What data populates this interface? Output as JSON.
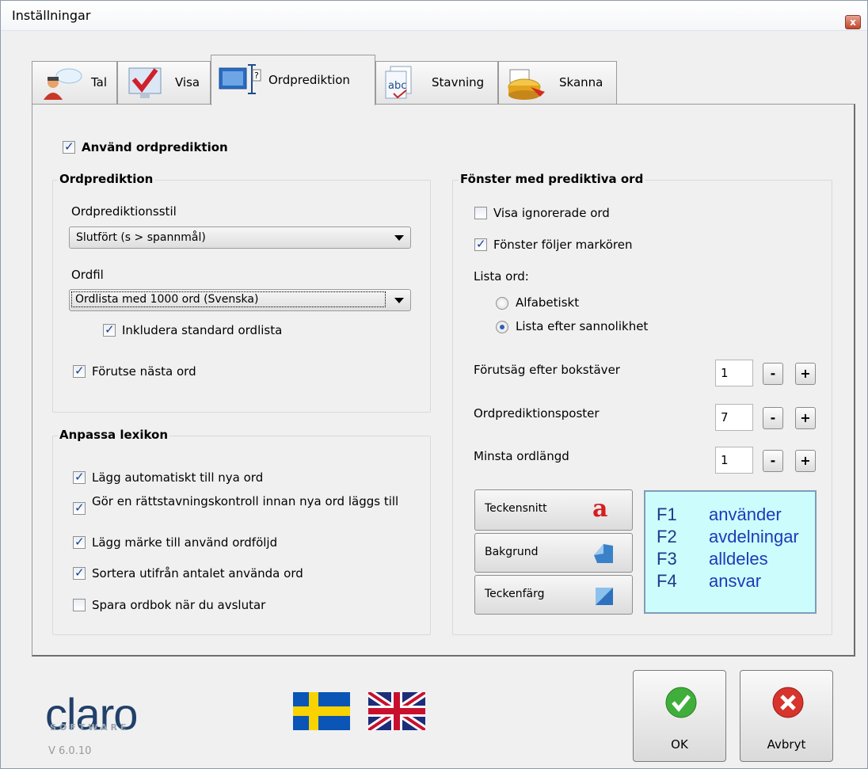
{
  "window": {
    "title": "Inställningar",
    "close_glyph": "x"
  },
  "tabs": [
    {
      "label": "Tal",
      "icon": "speaker-person-icon",
      "active": false
    },
    {
      "label": "Visa",
      "icon": "checkmark-screen-icon",
      "active": false
    },
    {
      "label": "Ordprediktion",
      "icon": "monitor-text-cursor-icon",
      "active": true
    },
    {
      "label": "Stavning",
      "icon": "abc-document-icon",
      "active": false
    },
    {
      "label": "Skanna",
      "icon": "scanner-icon",
      "active": false
    }
  ],
  "use_prediction": {
    "label": "Använd ordprediktion",
    "checked": true
  },
  "prediction_group": {
    "title": "Ordprediktion",
    "style_label": "Ordprediktionsstil",
    "style_value": "Slutfört (s > spannmål)",
    "wordfile_label": "Ordfil",
    "wordfile_value": "Ordlista med 1000 ord (Svenska)",
    "include_standard": {
      "label": "Inkludera standard ordlista",
      "checked": true
    },
    "predict_next": {
      "label": "Förutse nästa ord",
      "checked": true
    }
  },
  "lexicon_group": {
    "title": "Anpassa lexikon",
    "items": [
      {
        "label": "Lägg automatiskt till nya ord",
        "checked": true
      },
      {
        "label": "Gör en rättstavningskontroll innan nya ord läggs till",
        "checked": true
      },
      {
        "label": "Lägg märke till använd ordföljd",
        "checked": true
      },
      {
        "label": "Sortera utifrån antalet använda ord",
        "checked": true
      },
      {
        "label": "Spara ordbok när du avslutar",
        "checked": false
      }
    ]
  },
  "window_group": {
    "title": "Fönster med prediktiva ord",
    "show_ignored": {
      "label": "Visa ignorerade ord",
      "checked": false
    },
    "follow_cursor": {
      "label": "Fönster följer markören",
      "checked": true
    },
    "list_label": "Lista ord:",
    "radio_alpha": {
      "label": "Alfabetiskt",
      "selected": false
    },
    "radio_prob": {
      "label": "Lista efter sannolikhet",
      "selected": true
    },
    "after_letters": {
      "label": "Förutsäg efter bokstäver",
      "value": "1"
    },
    "entries": {
      "label": "Ordprediktionsposter",
      "value": "7"
    },
    "min_length": {
      "label": "Minsta ordlängd",
      "value": "1"
    },
    "spin_minus": "-",
    "spin_plus": "+",
    "font_button": "Teckensnitt",
    "background_button": "Bakgrund",
    "color_button": "Teckenfärg",
    "font_icon_glyph": "a",
    "preview": [
      {
        "key": "F1",
        "word": "använder"
      },
      {
        "key": "F2",
        "word": "avdelningar"
      },
      {
        "key": "F3",
        "word": "alldeles"
      },
      {
        "key": "F4",
        "word": "ansvar"
      }
    ]
  },
  "footer": {
    "logo": "claro",
    "logo_sub": "SOFTWARE",
    "version": "V 6.0.10",
    "ok_label": "OK",
    "cancel_label": "Avbryt"
  },
  "colors": {
    "accent": "#1e3ab8",
    "preview_bg": "#ccfcfc",
    "ok_green": "#3fae3a",
    "cancel_red": "#d6342c"
  }
}
